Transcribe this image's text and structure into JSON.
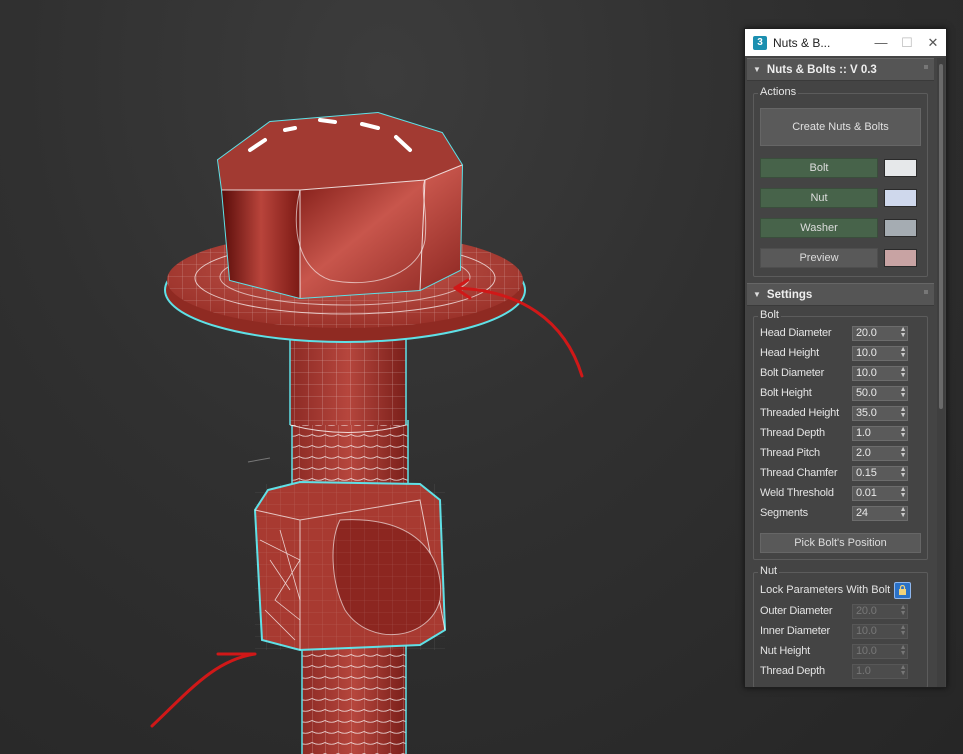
{
  "window": {
    "title": "Nuts & B...",
    "icon_label": "3",
    "minimize_glyph": "—",
    "maximize_glyph": "☐",
    "close_glyph": "✕"
  },
  "rollouts": {
    "main_title": "Nuts & Bolts :: V 0.3",
    "settings_title": "Settings"
  },
  "actions": {
    "label": "Actions",
    "create_label": "Create Nuts & Bolts",
    "items": [
      {
        "label": "Bolt",
        "color": "#e6e8ea"
      },
      {
        "label": "Nut",
        "color": "#cfd8ec"
      },
      {
        "label": "Washer",
        "color": "#a5acb2"
      },
      {
        "label": "Preview",
        "color": "#c8a3a3"
      }
    ]
  },
  "bolt": {
    "label": "Bolt",
    "params": [
      {
        "label": "Head Diameter",
        "value": "20.0"
      },
      {
        "label": "Head Height",
        "value": "10.0"
      },
      {
        "label": "Bolt Diameter",
        "value": "10.0"
      },
      {
        "label": "Bolt Height",
        "value": "50.0"
      },
      {
        "label": "Threaded Height",
        "value": "35.0"
      },
      {
        "label": "Thread Depth",
        "value": "1.0"
      },
      {
        "label": "Thread Pitch",
        "value": "2.0"
      },
      {
        "label": "Thread Chamfer",
        "value": "0.15"
      },
      {
        "label": "Weld Threshold",
        "value": "0.01"
      },
      {
        "label": "Segments",
        "value": "24"
      }
    ],
    "pick_label": "Pick Bolt's Position"
  },
  "nut": {
    "label": "Nut",
    "lock_label": "Lock Parameters With Bolt",
    "params": [
      {
        "label": "Outer Diameter",
        "value": "20.0"
      },
      {
        "label": "Inner Diameter",
        "value": "10.0"
      },
      {
        "label": "Nut Height",
        "value": "10.0"
      },
      {
        "label": "Thread Depth",
        "value": "1.0"
      }
    ]
  },
  "colors": {
    "model_red": "#a3342c",
    "selection_cyan": "#5fe0e6",
    "annotation_red": "#d01818"
  }
}
